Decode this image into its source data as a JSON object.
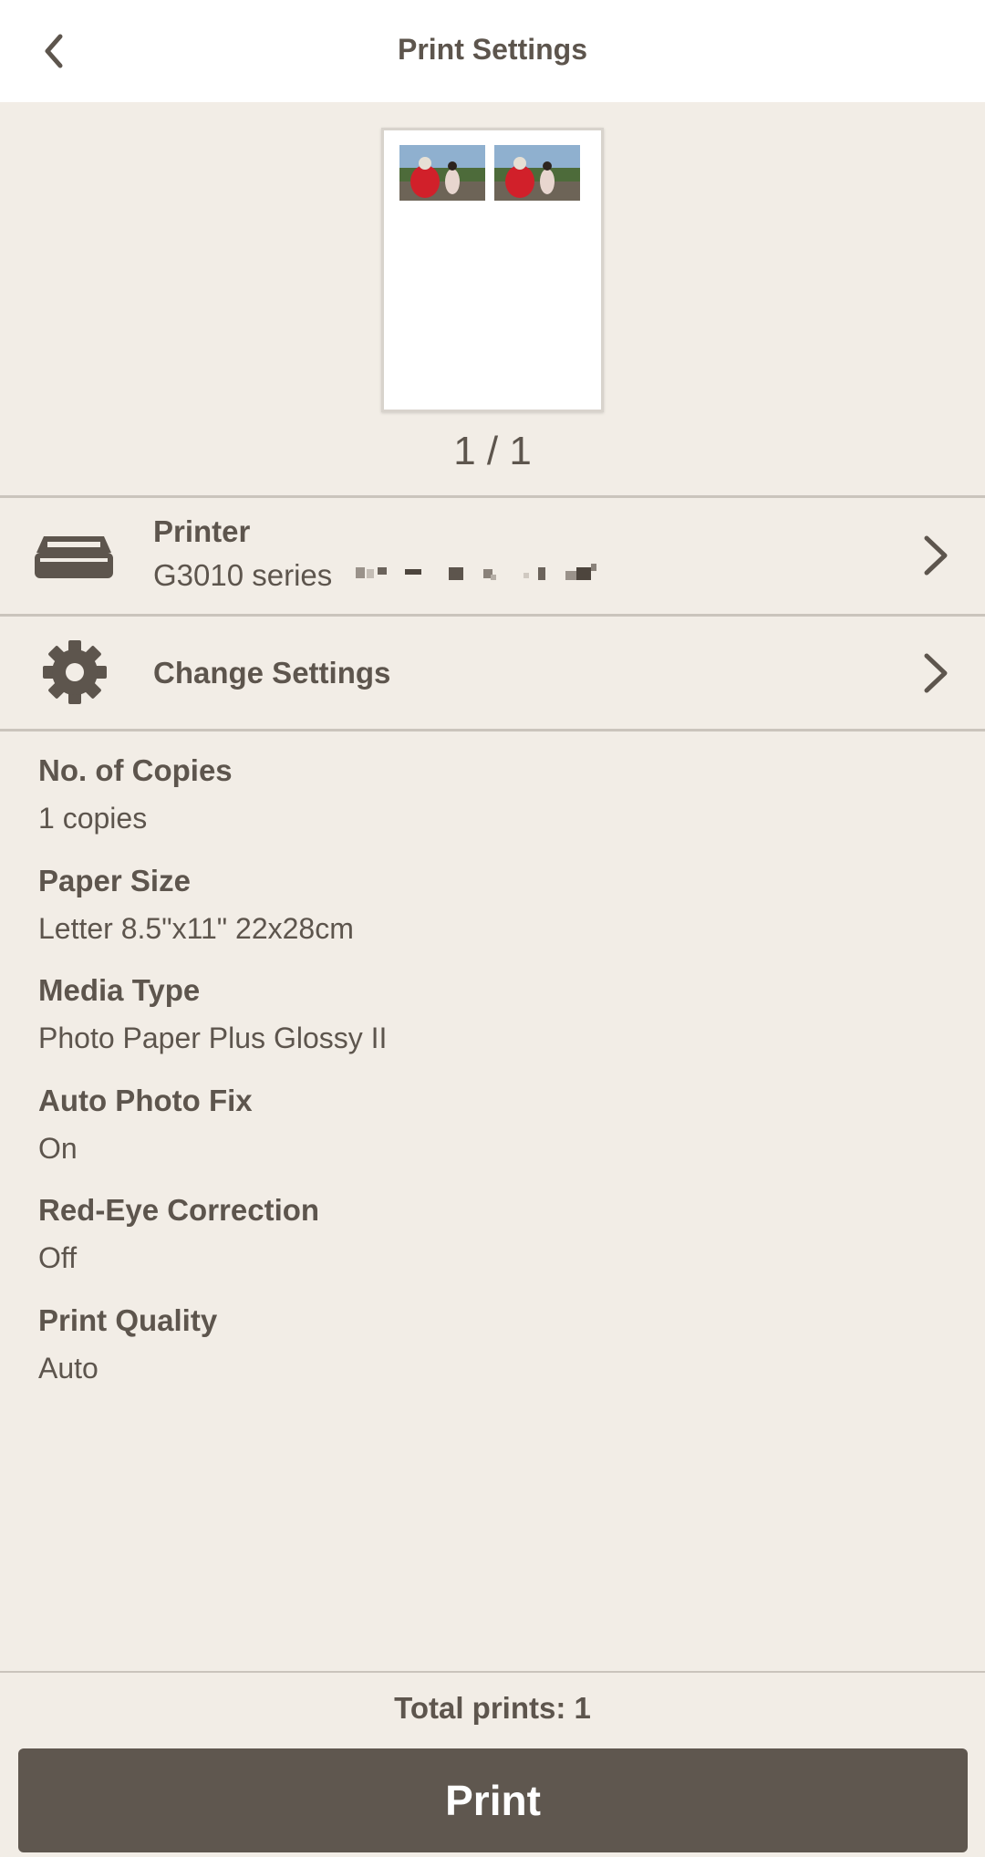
{
  "header": {
    "title": "Print Settings"
  },
  "preview": {
    "page_counter": "1 / 1"
  },
  "printer_row": {
    "label": "Printer",
    "name": "G3010 series"
  },
  "change_settings_row": {
    "label": "Change Settings"
  },
  "settings": [
    {
      "label": "No. of Copies",
      "value": "1 copies"
    },
    {
      "label": "Paper Size",
      "value": "Letter 8.5\"x11\" 22x28cm"
    },
    {
      "label": "Media Type",
      "value": "Photo Paper Plus Glossy II"
    },
    {
      "label": "Auto Photo Fix",
      "value": "On"
    },
    {
      "label": "Red-Eye Correction",
      "value": "Off"
    },
    {
      "label": "Print Quality",
      "value": "Auto"
    }
  ],
  "footer": {
    "total_prints": "Total prints: 1",
    "print_button": "Print"
  },
  "colors": {
    "background": "#f2ede6",
    "text": "#5d554d",
    "button": "#5f574f"
  },
  "icons": [
    "back-arrow-icon",
    "printer-icon",
    "gear-icon",
    "chevron-right-icon"
  ]
}
